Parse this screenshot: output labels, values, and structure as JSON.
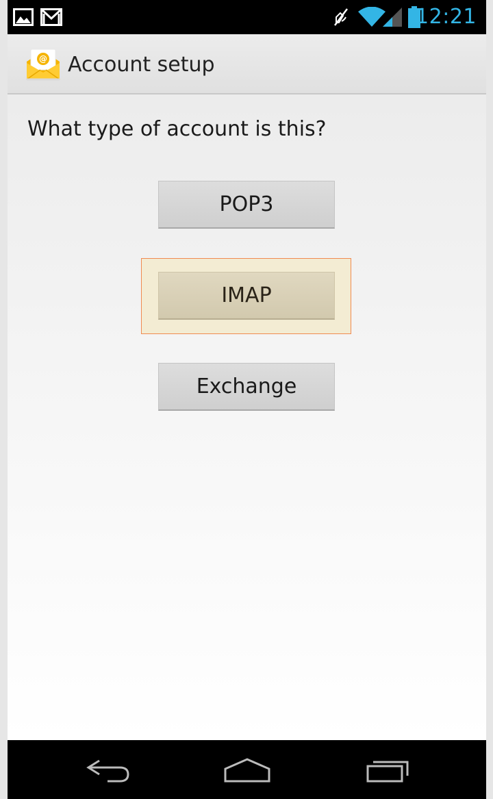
{
  "status_bar": {
    "time": "12:21",
    "icons": [
      "picture-icon",
      "gmail-icon",
      "mute-icon",
      "wifi-icon",
      "signal-icon",
      "battery-icon"
    ],
    "accent_color": "#33b5e5"
  },
  "action_bar": {
    "title": "Account setup",
    "app_icon": "email-envelope-icon"
  },
  "main": {
    "question": "What type of account is this?",
    "buttons": [
      {
        "label": "POP3",
        "focused": false
      },
      {
        "label": "IMAP",
        "focused": true
      },
      {
        "label": "Exchange",
        "focused": false
      }
    ],
    "focus_color": "#f08a50"
  },
  "nav_bar": {
    "buttons": [
      "back-icon",
      "home-icon",
      "recent-apps-icon"
    ]
  }
}
